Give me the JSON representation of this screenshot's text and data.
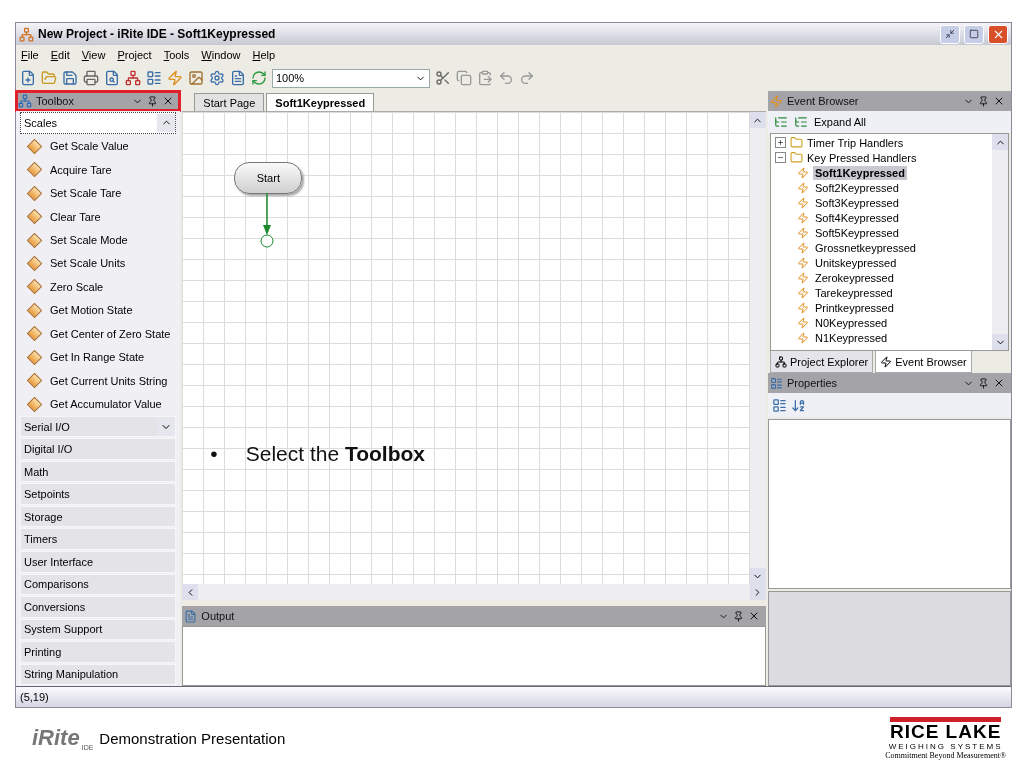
{
  "window": {
    "title": "New Project - iRite IDE - Soft1Keypressed"
  },
  "menu": [
    "File",
    "Edit",
    "View",
    "Project",
    "Tools",
    "Window",
    "Help"
  ],
  "toolbar": {
    "zoom": "100%"
  },
  "toolbox": {
    "title": "Toolbox",
    "highlighted": true,
    "categories": [
      {
        "label": "Scales",
        "expanded": true,
        "items": [
          "Get Scale Value",
          "Acquire Tare",
          "Set Scale Tare",
          "Clear Tare",
          "Set Scale Mode",
          "Set Scale Units",
          "Zero Scale",
          "Get Motion State",
          "Get Center of Zero State",
          "Get In Range State",
          "Get Current Units String",
          "Get Accumulator Value"
        ]
      },
      {
        "label": "Serial I/O",
        "expanded": false,
        "hovered": true
      },
      {
        "label": "Digital I/O",
        "expanded": false,
        "hovered": false
      },
      {
        "label": "Math",
        "expanded": false,
        "hovered": false
      },
      {
        "label": "Setpoints",
        "expanded": false,
        "hovered": false
      },
      {
        "label": "Storage",
        "expanded": false,
        "hovered": false
      },
      {
        "label": "Timers",
        "expanded": false,
        "hovered": false
      },
      {
        "label": "User Interface",
        "expanded": false,
        "hovered": false
      },
      {
        "label": "Comparisons",
        "expanded": false,
        "hovered": false
      },
      {
        "label": "Conversions",
        "expanded": false,
        "hovered": false
      },
      {
        "label": "System Support",
        "expanded": false,
        "hovered": false
      },
      {
        "label": "Printing",
        "expanded": false,
        "hovered": false
      },
      {
        "label": "String Manipulation",
        "expanded": false,
        "hovered": false
      }
    ]
  },
  "editor": {
    "tabs": [
      {
        "label": "Start Page",
        "selected": false
      },
      {
        "label": "Soft1Keypressed",
        "selected": true
      }
    ],
    "start_node": "Start"
  },
  "slide": {
    "bullet": "•",
    "text": "Select the **Toolbox**",
    "footer": "Demonstration Presentation",
    "logo": "iRite",
    "logo_sub": "IDE",
    "brand": "RICE LAKE",
    "brand_sub": "WEIGHING SYSTEMS",
    "brand_tagline": "Commitment Beyond Measurement®"
  },
  "output": {
    "title": "Output"
  },
  "event_browser": {
    "title": "Event Browser",
    "expand_all": "Expand All",
    "tree": [
      {
        "label": "Timer Trip Handlers",
        "expanded": false
      },
      {
        "label": "Key Pressed Handlers",
        "expanded": true,
        "children": [
          {
            "label": "Soft1Keypressed",
            "selected": true
          },
          {
            "label": "Soft2Keypressed",
            "selected": false
          },
          {
            "label": "Soft3Keypressed",
            "selected": false
          },
          {
            "label": "Soft4Keypressed",
            "selected": false
          },
          {
            "label": "Soft5Keypressed",
            "selected": false
          },
          {
            "label": "Grossnetkeypressed",
            "selected": false
          },
          {
            "label": "Unitskeypressed",
            "selected": false
          },
          {
            "label": "Zerokeypressed",
            "selected": false
          },
          {
            "label": "Tarekeypressed",
            "selected": false
          },
          {
            "label": "Printkeypressed",
            "selected": false
          },
          {
            "label": "N0Keypressed",
            "selected": false
          },
          {
            "label": "N1Keypressed",
            "selected": false
          }
        ]
      }
    ],
    "tabs": [
      {
        "label": "Project Explorer",
        "selected": false
      },
      {
        "label": "Event Browser",
        "selected": true
      }
    ]
  },
  "properties": {
    "title": "Properties"
  },
  "status_bar": {
    "position": "(5,19)"
  }
}
